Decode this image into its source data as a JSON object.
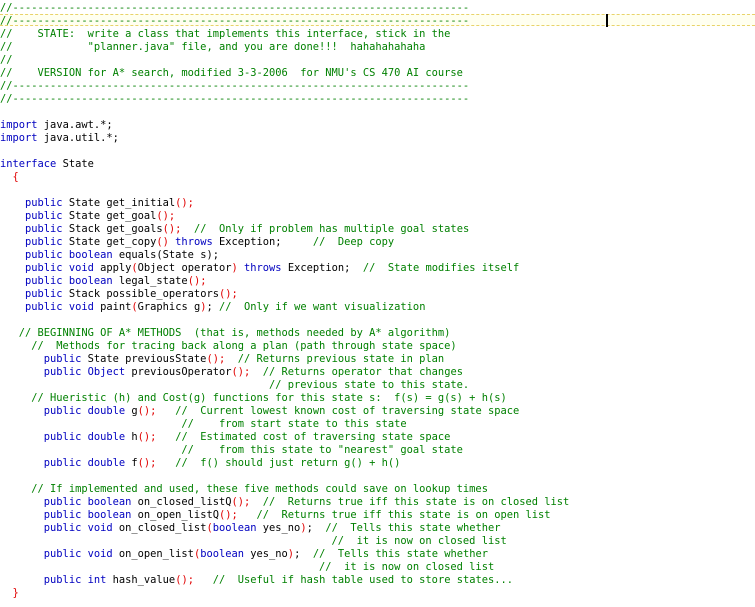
{
  "code": {
    "caret_line": 2,
    "lines": [
      [
        [
          "cm",
          "//-------------------------------------------------------------------------"
        ]
      ],
      [
        [
          "cm",
          "//-------------------------------------------------------------------------"
        ]
      ],
      [
        [
          "cm",
          "//    STATE:  write a class that implements this interface, stick in the"
        ]
      ],
      [
        [
          "cm",
          "//            \"planner.java\" file, and you are done!!!  hahahahahaha"
        ]
      ],
      [
        [
          "cm",
          "//"
        ]
      ],
      [
        [
          "cm",
          "//    VERSION for A* search, modified 3-3-2006  for NMU's CS 470 AI course"
        ]
      ],
      [
        [
          "cm",
          "//-------------------------------------------------------------------------"
        ]
      ],
      [
        [
          "cm",
          "//-------------------------------------------------------------------------"
        ]
      ],
      [],
      [
        [
          "kw",
          "import"
        ],
        [
          "tx",
          " java.awt.*;"
        ]
      ],
      [
        [
          "kw",
          "import"
        ],
        [
          "tx",
          " java.util.*;"
        ]
      ],
      [],
      [
        [
          "kw",
          "interface"
        ],
        [
          "tx",
          " State"
        ]
      ],
      [
        [
          "pn",
          "  {"
        ]
      ],
      [],
      [
        [
          "kw",
          "    public"
        ],
        [
          "tx",
          " State get_initial"
        ],
        [
          "pn",
          "();"
        ]
      ],
      [
        [
          "kw",
          "    public"
        ],
        [
          "tx",
          " State get_goal"
        ],
        [
          "pn",
          "();"
        ]
      ],
      [
        [
          "kw",
          "    public"
        ],
        [
          "tx",
          " Stack get_goals"
        ],
        [
          "pn",
          "();"
        ],
        [
          "cm",
          "  //  Only if problem has multiple goal states"
        ]
      ],
      [
        [
          "kw",
          "    public"
        ],
        [
          "tx",
          " State get_copy"
        ],
        [
          "pn",
          "()"
        ],
        [
          "kw",
          " throws"
        ],
        [
          "tx",
          " Exception;"
        ],
        [
          "cm",
          "     //  Deep copy"
        ]
      ],
      [
        [
          "kw",
          "    public"
        ],
        [
          "kw",
          " boolean"
        ],
        [
          "tx",
          " equals(State s);"
        ]
      ],
      [
        [
          "kw",
          "    public"
        ],
        [
          "kw",
          " void"
        ],
        [
          "tx",
          " apply"
        ],
        [
          "pn",
          "("
        ],
        [
          "tx",
          "Object operator"
        ],
        [
          "pn",
          ")"
        ],
        [
          "kw",
          " throws"
        ],
        [
          "tx",
          " Exception;"
        ],
        [
          "cm",
          "  //  State modifies itself"
        ]
      ],
      [
        [
          "kw",
          "    public"
        ],
        [
          "kw",
          " boolean"
        ],
        [
          "tx",
          " legal_state"
        ],
        [
          "pn",
          "();"
        ]
      ],
      [
        [
          "kw",
          "    public"
        ],
        [
          "tx",
          " Stack possible_operators"
        ],
        [
          "pn",
          "();"
        ]
      ],
      [
        [
          "kw",
          "    public"
        ],
        [
          "kw",
          " void"
        ],
        [
          "tx",
          " paint"
        ],
        [
          "pn",
          "("
        ],
        [
          "tx",
          "Graphics g"
        ],
        [
          "pn",
          ")"
        ],
        [
          "tx",
          ";"
        ],
        [
          "cm",
          " //  Only if we want visualization"
        ]
      ],
      [],
      [
        [
          "cm",
          "   // BEGINNING OF A* METHODS  (that is, methods needed by A* algorithm)"
        ]
      ],
      [
        [
          "cm",
          "     //  Methods for tracing back along a plan (path through state space)"
        ]
      ],
      [
        [
          "kw",
          "       public"
        ],
        [
          "tx",
          " State previousState"
        ],
        [
          "pn",
          "();"
        ],
        [
          "cm",
          "  // Returns previous state in plan"
        ]
      ],
      [
        [
          "kw",
          "       public"
        ],
        [
          "kw",
          " Object"
        ],
        [
          "tx",
          " previousOperator"
        ],
        [
          "pn",
          "();"
        ],
        [
          "cm",
          "  // Returns operator that changes"
        ]
      ],
      [
        [
          "cm",
          "                                           // previous state to this state."
        ]
      ],
      [
        [
          "cm",
          "     // Hueristic (h) and Cost(g) functions for this state s:  f(s) = g(s) + h(s)"
        ]
      ],
      [
        [
          "kw",
          "       public"
        ],
        [
          "kw",
          " double"
        ],
        [
          "tx",
          " g"
        ],
        [
          "pn",
          "();"
        ],
        [
          "cm",
          "   //  Current lowest known cost of traversing state space"
        ]
      ],
      [
        [
          "cm",
          "                             //    from start state to this state"
        ]
      ],
      [
        [
          "kw",
          "       public"
        ],
        [
          "kw",
          " double"
        ],
        [
          "tx",
          " h"
        ],
        [
          "pn",
          "();"
        ],
        [
          "cm",
          "   //  Estimated cost of traversing state space"
        ]
      ],
      [
        [
          "cm",
          "                             //    from this state to \"nearest\" goal state"
        ]
      ],
      [
        [
          "kw",
          "       public"
        ],
        [
          "kw",
          " double"
        ],
        [
          "tx",
          " f"
        ],
        [
          "pn",
          "();"
        ],
        [
          "cm",
          "   //  f() should just return g() + h()"
        ]
      ],
      [],
      [
        [
          "cm",
          "     // If implemented and used, these five methods could save on lookup times"
        ]
      ],
      [
        [
          "kw",
          "       public"
        ],
        [
          "kw",
          " boolean"
        ],
        [
          "tx",
          " on_closed_listQ"
        ],
        [
          "pn",
          "();"
        ],
        [
          "cm",
          "  //  Returns true iff this state is on closed list"
        ]
      ],
      [
        [
          "kw",
          "       public"
        ],
        [
          "kw",
          " boolean"
        ],
        [
          "tx",
          " on_open_listQ"
        ],
        [
          "pn",
          "();"
        ],
        [
          "cm",
          "   //  Returns true iff this state is on open list"
        ]
      ],
      [
        [
          "kw",
          "       public"
        ],
        [
          "kw",
          " void"
        ],
        [
          "tx",
          " on_closed_list"
        ],
        [
          "pn",
          "("
        ],
        [
          "kw",
          "boolean"
        ],
        [
          "tx",
          " yes_no"
        ],
        [
          "pn",
          ")"
        ],
        [
          "tx",
          ";"
        ],
        [
          "cm",
          "  //  Tells this state whether"
        ]
      ],
      [
        [
          "cm",
          "                                                     //  it is now on closed list"
        ]
      ],
      [
        [
          "kw",
          "       public"
        ],
        [
          "kw",
          " void"
        ],
        [
          "tx",
          " on_open_list"
        ],
        [
          "pn",
          "("
        ],
        [
          "kw",
          "boolean"
        ],
        [
          "tx",
          " yes_no"
        ],
        [
          "pn",
          ")"
        ],
        [
          "tx",
          ";"
        ],
        [
          "cm",
          "  //  Tells this state whether"
        ]
      ],
      [
        [
          "cm",
          "                                                   //  it is now on closed list"
        ]
      ],
      [
        [
          "kw",
          "       public"
        ],
        [
          "kw",
          " int"
        ],
        [
          "tx",
          " hash_value"
        ],
        [
          "pn",
          "();"
        ],
        [
          "cm",
          "   //  Useful if hash table used to store states..."
        ]
      ],
      [
        [
          "pn",
          "  }"
        ]
      ]
    ]
  }
}
